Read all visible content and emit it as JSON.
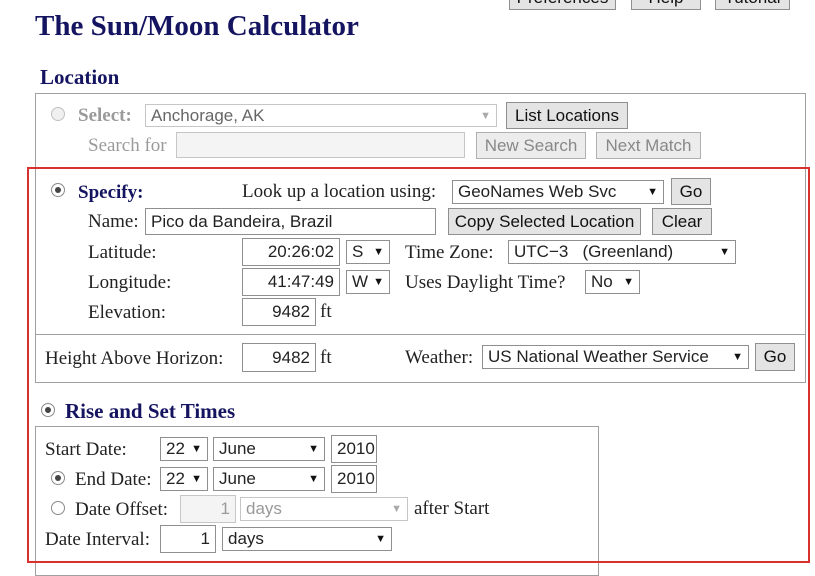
{
  "top_links": [
    "Preferences",
    "Help",
    "Tutorial"
  ],
  "page_title": "The Sun/Moon Calculator",
  "location": {
    "heading": "Location",
    "select": {
      "label": "Select:",
      "value": "Anchorage, AK",
      "list_button": "List Locations"
    },
    "search": {
      "label": "Search for",
      "value": "",
      "new_search_button": "New Search",
      "next_match_button": "Next Match"
    },
    "specify": {
      "label": "Specify:",
      "lookup_label": "Look up a location using:",
      "lookup_value": "GeoNames Web Svc",
      "go_button": "Go",
      "name_label": "Name:",
      "name_value": "Pico da Bandeira, Brazil",
      "copy_button": "Copy Selected Location",
      "clear_button": "Clear",
      "latitude_label": "Latitude:",
      "latitude_value": "20:26:02",
      "latitude_dir": "S",
      "timezone_label": "Time Zone:",
      "timezone_value": "UTC−3   (Greenland)",
      "longitude_label": "Longitude:",
      "longitude_value": "41:47:49",
      "longitude_dir": "W",
      "daylight_label": "Uses Daylight Time?",
      "daylight_value": "No",
      "elevation_label": "Elevation:",
      "elevation_value": "9482",
      "elevation_unit": "ft"
    },
    "horizon": {
      "label": "Height Above Horizon:",
      "value": "9482",
      "unit": "ft",
      "weather_label": "Weather:",
      "weather_value": "US National Weather Service",
      "go_button": "Go"
    }
  },
  "rise_set": {
    "heading": "Rise and Set Times",
    "start_label": "Start Date:",
    "start_day": "22",
    "start_month": "June",
    "start_year": "2010",
    "end_label": "End Date:",
    "end_day": "22",
    "end_month": "June",
    "end_year": "2010",
    "offset_label": "Date Offset:",
    "offset_value": "1",
    "offset_unit": "days",
    "offset_suffix": "after Start",
    "interval_label": "Date Interval:",
    "interval_value": "1",
    "interval_unit": "days"
  }
}
